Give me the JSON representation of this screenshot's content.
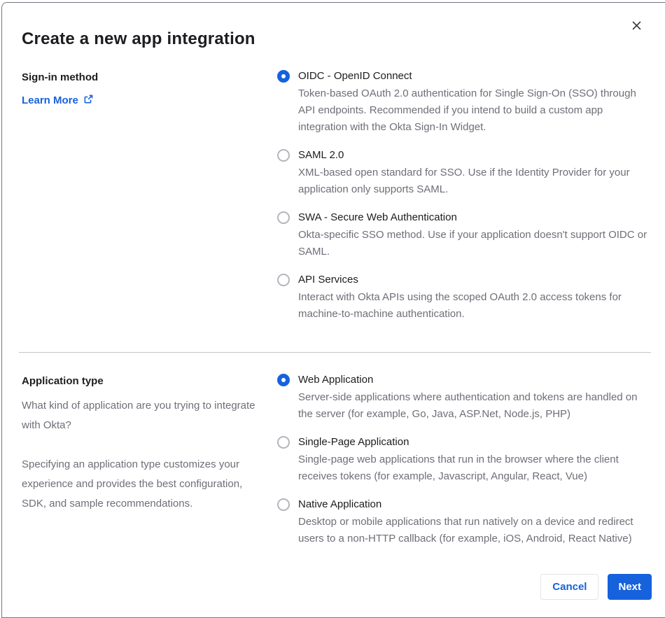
{
  "dialog": {
    "title": "Create a new app integration"
  },
  "signin": {
    "label": "Sign-in method",
    "learn_more_label": "Learn More",
    "options": [
      {
        "label": "OIDC - OpenID Connect",
        "description": "Token-based OAuth 2.0 authentication for Single Sign-On (SSO) through API endpoints. Recommended if you intend to build a custom app integration with the Okta Sign-In Widget.",
        "selected": true
      },
      {
        "label": "SAML 2.0",
        "description": "XML-based open standard for SSO. Use if the Identity Provider for your application only supports SAML.",
        "selected": false
      },
      {
        "label": "SWA - Secure Web Authentication",
        "description": "Okta-specific SSO method. Use if your application doesn't support OIDC or SAML.",
        "selected": false
      },
      {
        "label": "API Services",
        "description": "Interact with Okta APIs using the scoped OAuth 2.0 access tokens for machine-to-machine authentication.",
        "selected": false
      }
    ]
  },
  "app_type": {
    "label": "Application type",
    "paragraph1": "What kind of application are you trying to integrate with Okta?",
    "paragraph2": "Specifying an application type customizes your experience and provides the best configuration, SDK, and sample recommendations.",
    "options": [
      {
        "label": "Web Application",
        "description": "Server-side applications where authentication and tokens are handled on the server (for example, Go, Java, ASP.Net, Node.js, PHP)",
        "selected": true
      },
      {
        "label": "Single-Page Application",
        "description": "Single-page web applications that run in the browser where the client receives tokens (for example, Javascript, Angular, React, Vue)",
        "selected": false
      },
      {
        "label": "Native Application",
        "description": "Desktop or mobile applications that run natively on a device and redirect users to a non-HTTP callback (for example, iOS, Android, React Native)",
        "selected": false
      }
    ]
  },
  "footer": {
    "cancel_label": "Cancel",
    "next_label": "Next"
  },
  "icons": {
    "close": "close-icon",
    "external_link": "external-link-icon"
  },
  "colors": {
    "accent_blue": "#1662dd",
    "text_dark": "#1d1d21",
    "text_gray": "#6e6e78",
    "radio_border": "#b5b5bd",
    "divider": "#c4c4c9"
  }
}
